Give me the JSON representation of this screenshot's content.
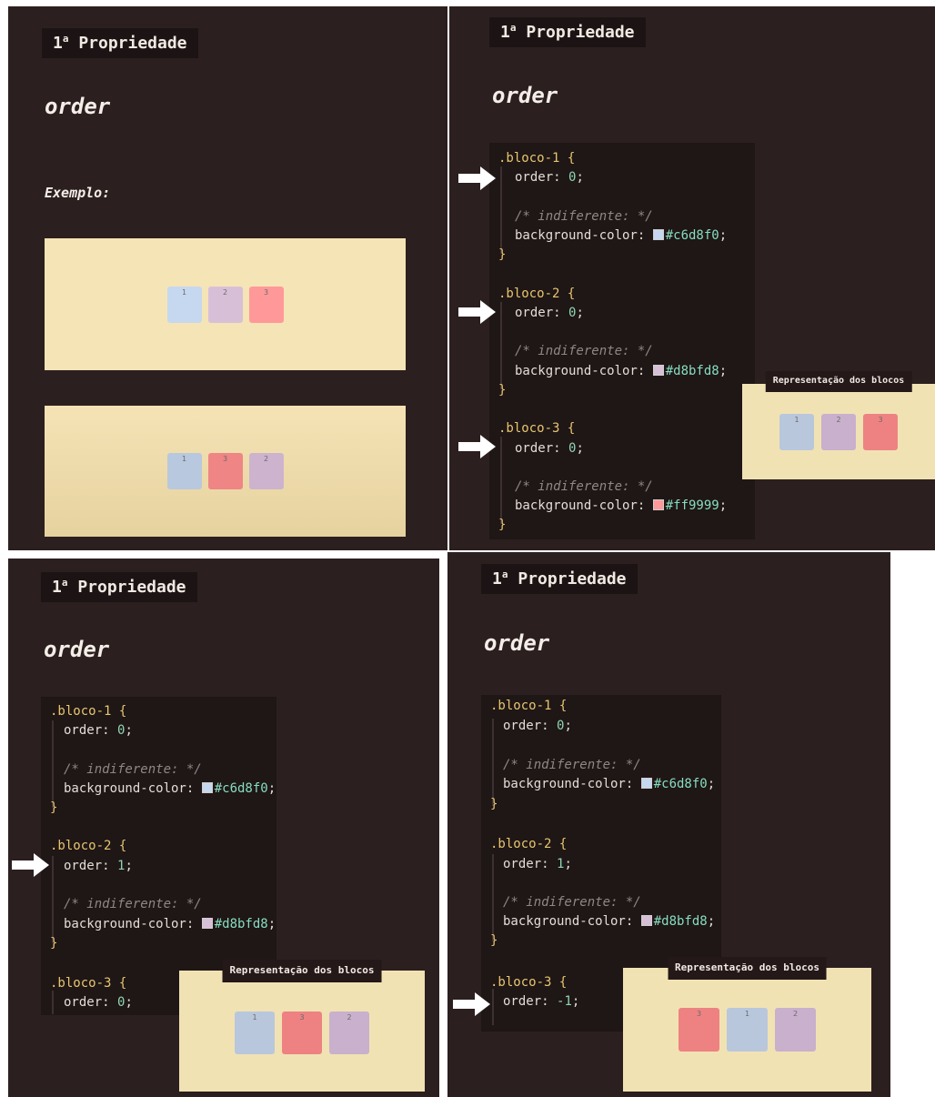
{
  "heading": {
    "prefix": "1",
    "sup": "a",
    "text": "Propriedade"
  },
  "property_title": "order",
  "example_label": "Exemplo:",
  "representation_label": "Representação dos blocos",
  "colors": {
    "panel_bg": "#2c1f1f",
    "stage_bg": "#f5e4b5",
    "block1": "#c6d8f0",
    "block2": "#d8bfd8",
    "block3": "#ff9999"
  },
  "panels": {
    "p1": {
      "example_rows": [
        {
          "blocks": [
            {
              "label": "1",
              "color": "#c6d8f0"
            },
            {
              "label": "2",
              "color": "#d8bfd8"
            },
            {
              "label": "3",
              "color": "#ff9999"
            }
          ]
        },
        {
          "blocks": [
            {
              "label": "1",
              "color": "#b8c8de"
            },
            {
              "label": "3",
              "color": "#ef8585"
            },
            {
              "label": "2",
              "color": "#cdb3ce"
            }
          ]
        }
      ]
    },
    "p2": {
      "code": {
        "b1_sel": ".bloco-1 {",
        "b1_prop": "order: ",
        "b1_val": "0",
        "b1_cmt": "/* indiferente: */",
        "b1_bg": "background-color: ",
        "b1_hex": "#c6d8f0",
        "b2_sel": ".bloco-2 {",
        "b2_prop": "order: ",
        "b2_val": "0",
        "b2_cmt": "/* indiferente: */",
        "b2_bg": "background-color: ",
        "b2_hex": "#d8bfd8",
        "b3_sel": ".bloco-3 {",
        "b3_prop": "order: ",
        "b3_val": "0",
        "b3_cmt": "/* indiferente: */",
        "b3_bg": "background-color: ",
        "b3_hex": "#ff9999",
        "close": "}"
      },
      "rep_blocks": [
        {
          "label": "1",
          "color": "#b9c7dd"
        },
        {
          "label": "2",
          "color": "#c9b0cc"
        },
        {
          "label": "3",
          "color": "#ee8282"
        }
      ]
    },
    "p3": {
      "code": {
        "b1_sel": ".bloco-1 {",
        "b1_prop": "order: ",
        "b1_val": "0",
        "b1_cmt": "/* indiferente: */",
        "b1_bg": "background-color: ",
        "b1_hex": "#c6d8f0",
        "b2_sel": ".bloco-2 {",
        "b2_prop": "order: ",
        "b2_val": "1",
        "b2_cmt": "/* indiferente: */",
        "b2_bg": "background-color: ",
        "b2_hex": "#d8bfd8",
        "b3_sel": ".bloco-3 {",
        "b3_prop": "order: ",
        "b3_val": "0",
        "close": "}"
      },
      "rep_blocks": [
        {
          "label": "1",
          "color": "#b9c7dd"
        },
        {
          "label": "3",
          "color": "#ee8282"
        },
        {
          "label": "2",
          "color": "#c9b0cc"
        }
      ]
    },
    "p4": {
      "code": {
        "b1_sel": ".bloco-1 {",
        "b1_prop": "order: ",
        "b1_val": "0",
        "b1_cmt": "/* indiferente: */",
        "b1_bg": "background-color: ",
        "b1_hex": "#c6d8f0",
        "b2_sel": ".bloco-2 {",
        "b2_prop": "order: ",
        "b2_val": "1",
        "b2_cmt": "/* indiferente: */",
        "b2_bg": "background-color: ",
        "b2_hex": "#d8bfd8",
        "b3_sel": ".bloco-3 {",
        "b3_prop": "order: ",
        "b3_val": "-1",
        "close": "}"
      },
      "rep_blocks": [
        {
          "label": "3",
          "color": "#ee8282"
        },
        {
          "label": "1",
          "color": "#b9c7dd"
        },
        {
          "label": "2",
          "color": "#c9b0cc"
        }
      ]
    }
  }
}
